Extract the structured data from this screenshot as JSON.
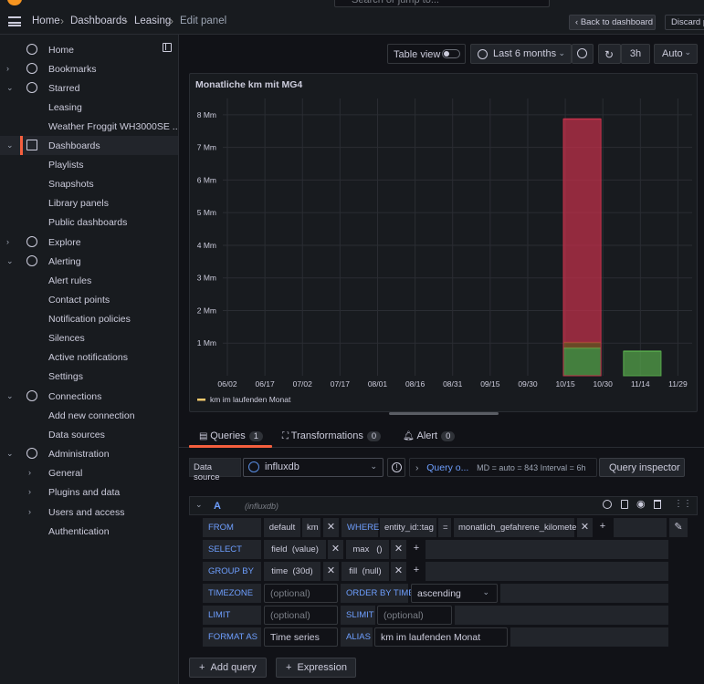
{
  "topbar": {
    "search_placeholder": "Search or jump to...",
    "breadcrumb": [
      "Home",
      "Dashboards",
      "Leasing",
      "Edit panel"
    ],
    "back_label": "Back to dashboard",
    "discard_label": "Discard pa"
  },
  "sidebar": {
    "items": [
      {
        "label": "Home"
      },
      {
        "label": "Bookmarks"
      },
      {
        "label": "Starred"
      },
      {
        "label": "Leasing"
      },
      {
        "label": "Weather Froggit WH3000SE ..."
      },
      {
        "label": "Dashboards"
      },
      {
        "label": "Playlists"
      },
      {
        "label": "Snapshots"
      },
      {
        "label": "Library panels"
      },
      {
        "label": "Public dashboards"
      },
      {
        "label": "Explore"
      },
      {
        "label": "Alerting"
      },
      {
        "label": "Alert rules"
      },
      {
        "label": "Contact points"
      },
      {
        "label": "Notification policies"
      },
      {
        "label": "Silences"
      },
      {
        "label": "Active notifications"
      },
      {
        "label": "Settings"
      },
      {
        "label": "Connections"
      },
      {
        "label": "Add new connection"
      },
      {
        "label": "Data sources"
      },
      {
        "label": "Administration"
      },
      {
        "label": "General"
      },
      {
        "label": "Plugins and data"
      },
      {
        "label": "Users and access"
      },
      {
        "label": "Authentication"
      }
    ]
  },
  "toolbar": {
    "table_view": "Table view",
    "time_range": "Last 6 months",
    "refresh_interval": "3h",
    "auto": "Auto"
  },
  "panel": {
    "title": "Monatliche km mit MG4"
  },
  "chart_data": {
    "type": "bar",
    "title": "Monatliche km mit MG4",
    "x_tick_labels": [
      "06/02",
      "06/17",
      "07/02",
      "07/17",
      "08/01",
      "08/16",
      "08/31",
      "09/15",
      "09/30",
      "10/15",
      "10/30",
      "11/14",
      "11/29"
    ],
    "y_tick_labels": [
      "1 Mm",
      "2 Mm",
      "3 Mm",
      "4 Mm",
      "5 Mm",
      "6 Mm",
      "7 Mm",
      "8 Mm"
    ],
    "ylim": [
      0,
      8500000
    ],
    "bars": [
      {
        "period": "10/01 - 10/30",
        "segments": [
          {
            "value": 850000,
            "color": "#56a64b"
          },
          {
            "value": 170000,
            "color": "#8a5a2a"
          },
          {
            "value": 6850000,
            "color": "#c4314b"
          }
        ]
      },
      {
        "period": "10/31 - 11/29",
        "segments": [
          {
            "value": 750000,
            "color": "#56a64b"
          }
        ]
      }
    ],
    "series": [
      {
        "name": "km im laufenden Monat",
        "color": "#f2c96d"
      }
    ],
    "grid": true,
    "legend": "bottom-left"
  },
  "tabs": {
    "queries": "Queries",
    "queries_count": "1",
    "transformations": "Transformations",
    "transformations_count": "0",
    "alert": "Alert",
    "alert_count": "0"
  },
  "datasource": {
    "label": "Data source",
    "name": "influxdb",
    "query_options": "Query o...",
    "meta": "MD = auto = 843    Interval = 6h",
    "inspector": "Query inspector"
  },
  "query": {
    "ref": "A",
    "source": "(influxdb)",
    "from_kw": "FROM",
    "from_policy": "default",
    "from_measurement": "km",
    "where_kw": "WHERE",
    "where_key": "entity_id::tag",
    "where_op": "=",
    "where_value": "monatlich_gefahrene_kilometer",
    "select_kw": "SELECT",
    "select_field": "field",
    "select_field_arg": "(value)",
    "select_fn": "max",
    "select_fn_arg": "()",
    "groupby_kw": "GROUP BY",
    "groupby_time": "time",
    "groupby_time_arg": "(30d)",
    "groupby_fill": "fill",
    "groupby_fill_arg": "(null)",
    "timezone_kw": "TIMEZONE",
    "timezone_placeholder": "(optional)",
    "orderby_kw": "ORDER BY TIME",
    "orderby_value": "ascending",
    "limit_kw": "LIMIT",
    "limit_placeholder": "(optional)",
    "slimit_kw": "SLIMIT",
    "slimit_placeholder": "(optional)",
    "format_kw": "FORMAT AS",
    "format_value": "Time series",
    "alias_kw": "ALIAS",
    "alias_value": "km im laufenden Monat"
  },
  "actions": {
    "add_query": "Add query",
    "expression": "Expression"
  }
}
